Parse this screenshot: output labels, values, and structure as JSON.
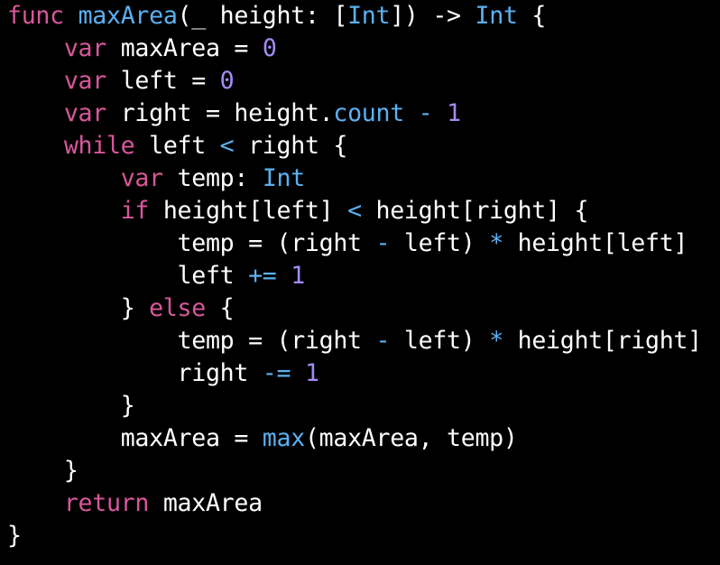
{
  "editor": {
    "language": "Swift",
    "background": "#000000",
    "colors": {
      "keyword": "#d9579b",
      "type": "#5ab1f2",
      "func": "#5ab1f2",
      "number": "#a48bf5",
      "operator": "#5ab1f2",
      "plain": "#ffffff"
    },
    "lines": [
      {
        "indent": 0,
        "tokens": [
          {
            "t": "func",
            "k": "keyword"
          },
          {
            "t": " ",
            "k": "plain"
          },
          {
            "t": "maxArea",
            "k": "func"
          },
          {
            "t": "(_ height: [",
            "k": "plain"
          },
          {
            "t": "Int",
            "k": "type"
          },
          {
            "t": "]) -> ",
            "k": "plain"
          },
          {
            "t": "Int",
            "k": "type"
          },
          {
            "t": " {",
            "k": "plain"
          }
        ]
      },
      {
        "indent": 4,
        "tokens": [
          {
            "t": "var",
            "k": "keyword"
          },
          {
            "t": " maxArea = ",
            "k": "plain"
          },
          {
            "t": "0",
            "k": "number"
          }
        ]
      },
      {
        "indent": 4,
        "tokens": [
          {
            "t": "var",
            "k": "keyword"
          },
          {
            "t": " left = ",
            "k": "plain"
          },
          {
            "t": "0",
            "k": "number"
          }
        ]
      },
      {
        "indent": 4,
        "tokens": [
          {
            "t": "var",
            "k": "keyword"
          },
          {
            "t": " right = height.",
            "k": "plain"
          },
          {
            "t": "count",
            "k": "func"
          },
          {
            "t": " ",
            "k": "plain"
          },
          {
            "t": "-",
            "k": "operator"
          },
          {
            "t": " ",
            "k": "plain"
          },
          {
            "t": "1",
            "k": "number"
          }
        ]
      },
      {
        "indent": 4,
        "tokens": [
          {
            "t": "while",
            "k": "keyword"
          },
          {
            "t": " left ",
            "k": "plain"
          },
          {
            "t": "<",
            "k": "operator"
          },
          {
            "t": " right {",
            "k": "plain"
          }
        ]
      },
      {
        "indent": 8,
        "tokens": [
          {
            "t": "var",
            "k": "keyword"
          },
          {
            "t": " temp: ",
            "k": "plain"
          },
          {
            "t": "Int",
            "k": "type"
          }
        ]
      },
      {
        "indent": 8,
        "tokens": [
          {
            "t": "if",
            "k": "keyword"
          },
          {
            "t": " height[left] ",
            "k": "plain"
          },
          {
            "t": "<",
            "k": "operator"
          },
          {
            "t": " height[right] {",
            "k": "plain"
          }
        ]
      },
      {
        "indent": 12,
        "tokens": [
          {
            "t": "temp = (right ",
            "k": "plain"
          },
          {
            "t": "-",
            "k": "operator"
          },
          {
            "t": " left) ",
            "k": "plain"
          },
          {
            "t": "*",
            "k": "operator"
          },
          {
            "t": " height[left]",
            "k": "plain"
          }
        ]
      },
      {
        "indent": 12,
        "tokens": [
          {
            "t": "left ",
            "k": "plain"
          },
          {
            "t": "+=",
            "k": "operator"
          },
          {
            "t": " ",
            "k": "plain"
          },
          {
            "t": "1",
            "k": "number"
          }
        ]
      },
      {
        "indent": 8,
        "tokens": [
          {
            "t": "} ",
            "k": "plain"
          },
          {
            "t": "else",
            "k": "keyword"
          },
          {
            "t": " {",
            "k": "plain"
          }
        ]
      },
      {
        "indent": 12,
        "tokens": [
          {
            "t": "temp = (right ",
            "k": "plain"
          },
          {
            "t": "-",
            "k": "operator"
          },
          {
            "t": " left) ",
            "k": "plain"
          },
          {
            "t": "*",
            "k": "operator"
          },
          {
            "t": " height[right]",
            "k": "plain"
          }
        ]
      },
      {
        "indent": 12,
        "tokens": [
          {
            "t": "right ",
            "k": "plain"
          },
          {
            "t": "-=",
            "k": "operator"
          },
          {
            "t": " ",
            "k": "plain"
          },
          {
            "t": "1",
            "k": "number"
          }
        ]
      },
      {
        "indent": 8,
        "tokens": [
          {
            "t": "}",
            "k": "plain"
          }
        ]
      },
      {
        "indent": 8,
        "tokens": [
          {
            "t": "maxArea = ",
            "k": "plain"
          },
          {
            "t": "max",
            "k": "func"
          },
          {
            "t": "(maxArea, temp)",
            "k": "plain"
          }
        ]
      },
      {
        "indent": 4,
        "tokens": [
          {
            "t": "}",
            "k": "plain"
          }
        ]
      },
      {
        "indent": 4,
        "tokens": [
          {
            "t": "return",
            "k": "keyword"
          },
          {
            "t": " maxArea",
            "k": "plain"
          }
        ]
      },
      {
        "indent": 0,
        "tokens": [
          {
            "t": "}",
            "k": "plain"
          }
        ]
      }
    ]
  }
}
